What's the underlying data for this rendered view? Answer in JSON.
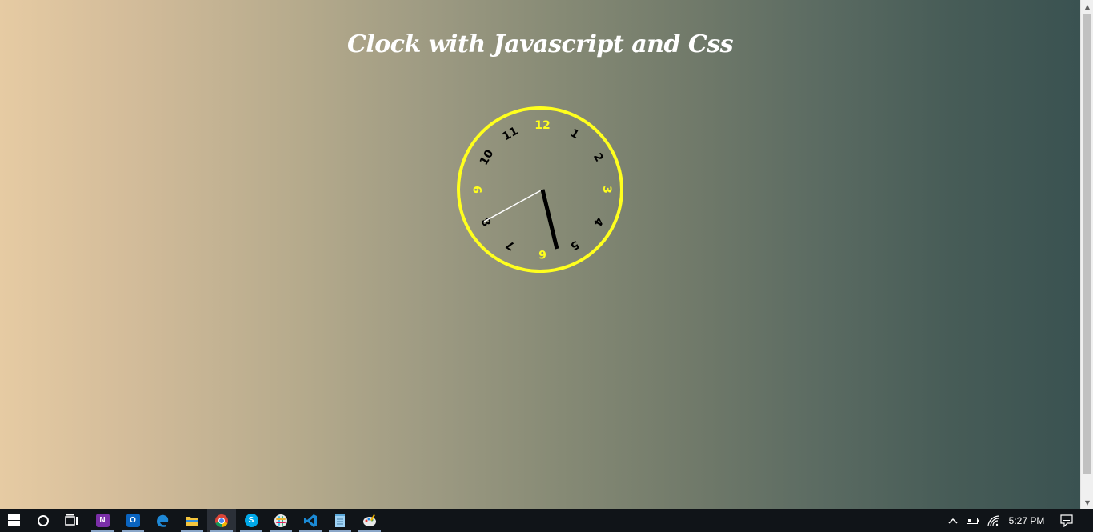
{
  "page": {
    "title": "Clock with Javascript and Css"
  },
  "clock": {
    "numbers": [
      "12",
      "1",
      "2",
      "3",
      "4",
      "5",
      "6",
      "7",
      "8",
      "9",
      "10",
      "11"
    ],
    "accent_color": "#ffff1e",
    "number_color": "#000000",
    "hour_hand_color": "#000000",
    "second_hand_color": "#ffffff"
  },
  "taskbar": {
    "apps": [
      {
        "name": "start-icon"
      },
      {
        "name": "cortana-icon"
      },
      {
        "name": "task-view-icon"
      },
      {
        "name": "onenote-icon",
        "glyph": "N",
        "color": "#7b2fa8"
      },
      {
        "name": "outlook-icon",
        "glyph": "O",
        "color": "#0a64c0"
      },
      {
        "name": "edge-icon",
        "glyph": "e",
        "color": "#1e88d6"
      },
      {
        "name": "file-explorer-icon",
        "color": "#f3c53d"
      },
      {
        "name": "chrome-icon"
      },
      {
        "name": "skype-icon",
        "glyph": "S",
        "color": "#00a8e8"
      },
      {
        "name": "slack-icon",
        "color": "#e8e8e8"
      },
      {
        "name": "vscode-icon",
        "color": "#1b8ad6"
      },
      {
        "name": "notepad-icon",
        "color": "#9fd3f5"
      },
      {
        "name": "paint-icon",
        "color": "#e8e8e8"
      }
    ],
    "time": "5:27 PM"
  }
}
